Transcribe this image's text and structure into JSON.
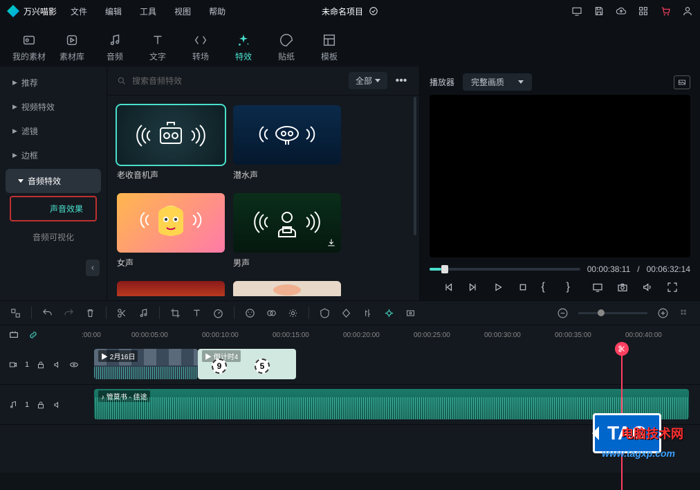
{
  "app": {
    "name": "万兴喵影",
    "project": "未命名项目"
  },
  "menu": {
    "file": "文件",
    "edit": "编辑",
    "tool": "工具",
    "view": "视图",
    "help": "帮助"
  },
  "tabs": {
    "my": "我的素材",
    "lib": "素材库",
    "audio": "音频",
    "text": "文字",
    "trans": "转场",
    "fx": "特效",
    "sticker": "贴纸",
    "tmpl": "模板"
  },
  "sidebar": {
    "recommend": "推荐",
    "videofx": "视频特效",
    "filter": "滤镜",
    "border": "边框",
    "audiofx": "音频特效",
    "soundfx": "声音效果",
    "audioviz": "音频可视化"
  },
  "search": {
    "placeholder": "搜索音频特效",
    "all": "全部"
  },
  "cards": {
    "c1": "老收音机声",
    "c2": "潜水声",
    "c3": "女声",
    "c4": "男声"
  },
  "preview": {
    "label": "播放器",
    "quality": "完整画质",
    "time_cur": "00:00:38:11",
    "time_tot": "00:06:32:14",
    "div": "/"
  },
  "ruler": {
    "t0": ":00:00",
    "t1": "00:00:05:00",
    "t2": "00:00:10:00",
    "t3": "00:00:15:00",
    "t4": "00:00:20:00",
    "t5": "00:00:25:00",
    "t6": "00:00:30:00",
    "t7": "00:00:35:00",
    "t8": "00:00:40:00"
  },
  "tracks": {
    "v_idx": "1",
    "a_idx": "1",
    "clip1": "2月16日",
    "clip2": "倒计时4",
    "clip3": "管莫书 - 佳途"
  },
  "watermark": {
    "tag": "TAG",
    "site": "电脑技术网",
    "url": "www.tagxp.com"
  }
}
